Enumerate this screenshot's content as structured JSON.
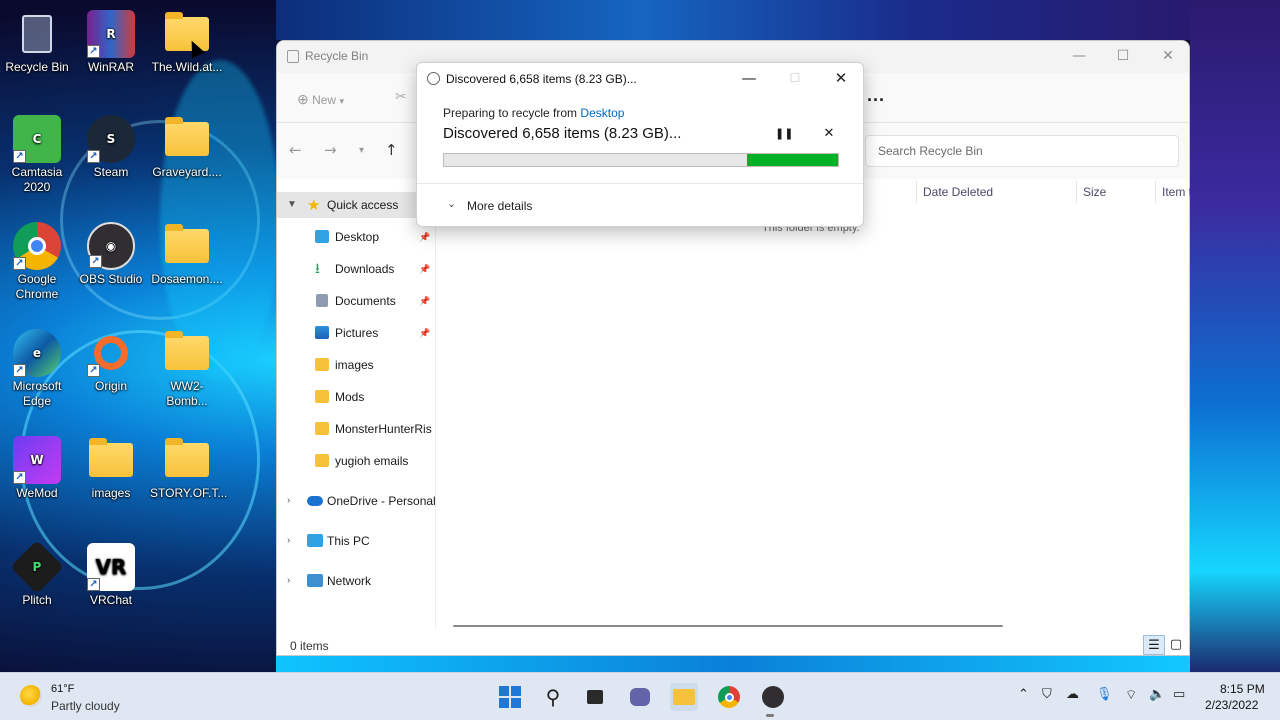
{
  "desktop": {
    "icons": [
      {
        "label": "Recycle Bin",
        "icon": "recycle-bin-icon"
      },
      {
        "label": "WinRAR",
        "icon": "winrar-icon"
      },
      {
        "label": "The.Wild.at...",
        "icon": "folder-icon"
      },
      {
        "label": "Camtasia 2020",
        "icon": "camtasia-icon"
      },
      {
        "label": "Steam",
        "icon": "steam-icon"
      },
      {
        "label": "Graveyard....",
        "icon": "folder-icon"
      },
      {
        "label": "Google Chrome",
        "icon": "chrome-icon"
      },
      {
        "label": "OBS Studio",
        "icon": "obs-icon"
      },
      {
        "label": "Dosaemon....",
        "icon": "folder-icon"
      },
      {
        "label": "Microsoft Edge",
        "icon": "edge-icon"
      },
      {
        "label": "Origin",
        "icon": "origin-icon"
      },
      {
        "label": "WW2-Bomb...",
        "icon": "folder-icon"
      },
      {
        "label": "WeMod",
        "icon": "wemod-icon"
      },
      {
        "label": "images",
        "icon": "folder-icon"
      },
      {
        "label": "STORY.OF.T...",
        "icon": "folder-icon"
      },
      {
        "label": "Plitch",
        "icon": "plitch-icon"
      },
      {
        "label": "VRChat",
        "icon": "vrchat-icon"
      }
    ]
  },
  "explorer": {
    "title": "Recycle Bin",
    "toolbar": {
      "new_label": "New",
      "more_label": "..."
    },
    "search_placeholder": "Search Recycle Bin",
    "columns": [
      "Date Deleted",
      "Size",
      "Item t"
    ],
    "empty_message": "This folder is empty.",
    "status": "0 items",
    "sidebar": {
      "quick_access": "Quick access",
      "items": [
        "Desktop",
        "Downloads",
        "Documents",
        "Pictures",
        "images",
        "Mods",
        "MonsterHunterRis",
        "yugioh emails"
      ],
      "onedrive": "OneDrive - Personal",
      "this_pc": "This PC",
      "network": "Network"
    }
  },
  "dialog": {
    "title": "Discovered 6,658 items (8.23 GB)...",
    "preparing_prefix": "Preparing to recycle from",
    "source_link": "Desktop",
    "main_status": "Discovered 6,658 items (8.23 GB)...",
    "progress_percent": 23,
    "more_details": "More details"
  },
  "taskbar": {
    "weather": {
      "temp": "61°F",
      "desc": "Partly cloudy"
    },
    "apps": [
      "start-icon",
      "search-icon",
      "task-view-icon",
      "chat-icon",
      "file-explorer-icon",
      "chrome-icon",
      "obs-icon"
    ],
    "clock": {
      "time": "8:15 PM",
      "date": "2/23/2022"
    }
  },
  "colors": {
    "accent": "#0067c0",
    "progress": "#06b025"
  }
}
